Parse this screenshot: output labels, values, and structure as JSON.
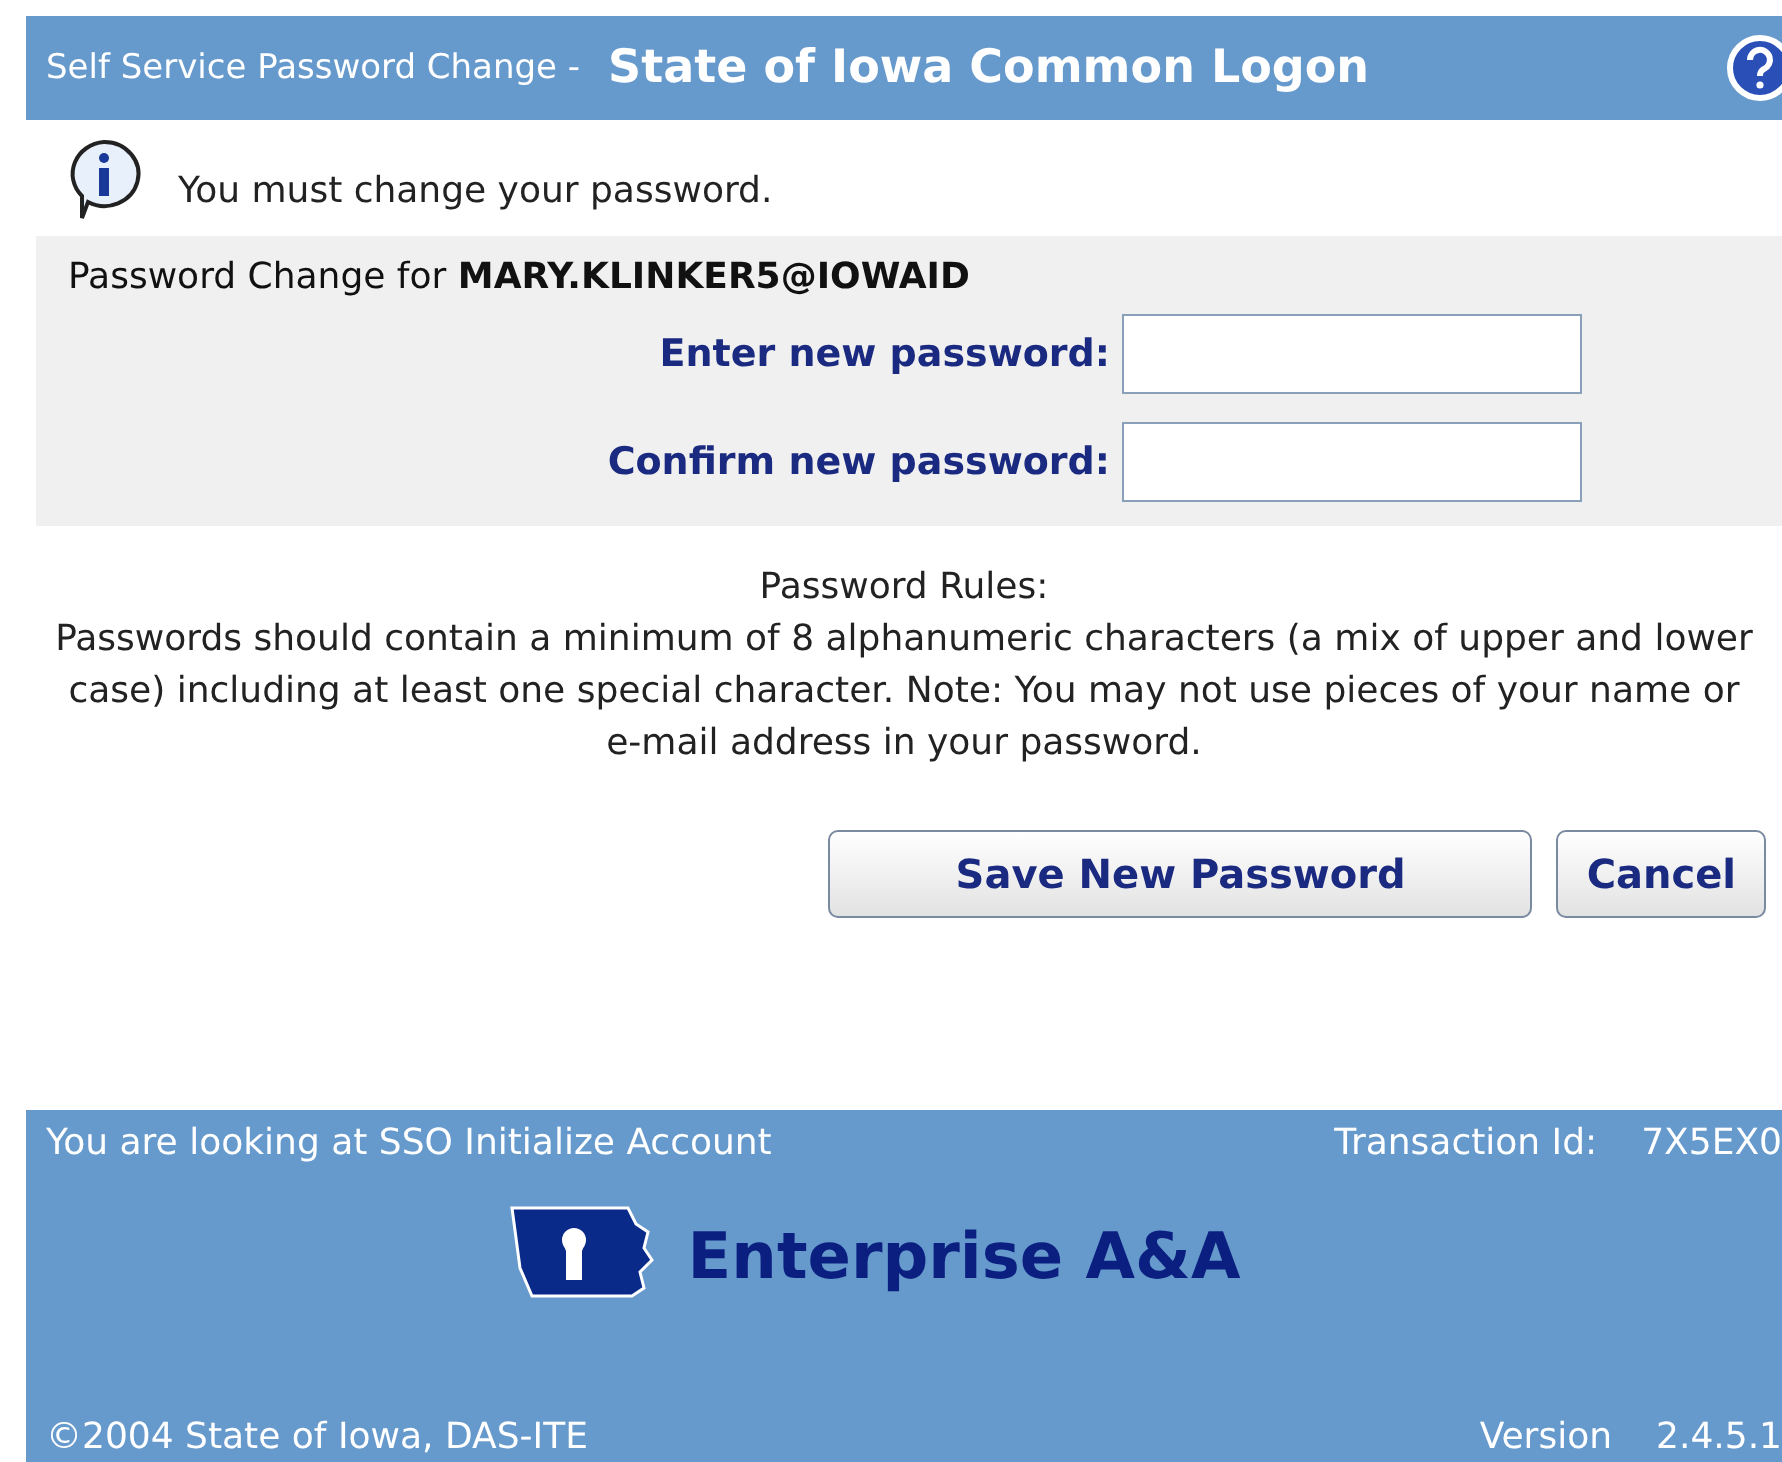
{
  "header": {
    "subtitle": "Self Service Password Change -",
    "title": "State of Iowa Common Logon"
  },
  "message": "You must change your password.",
  "form": {
    "heading": "Password Change for **MARY.KLINKER5@IOWAID**",
    "fields": [
      {
        "label": "Enter new password:"
      },
      {
        "label": "Confirm new password:"
      }
    ]
  },
  "rules": {
    "title": "Password Rules:",
    "text": "Passwords should contain a minimum of 8 alphanumeric characters (a mix of upper and lower case) including at least one special character. Note: You may not use pieces of your name or e-mail address in your password."
  },
  "buttons": [
    "Save New Password",
    "Cancel"
  ],
  "footer": {
    "location": "You are looking at SSO Initialize Account",
    "transaction_label": "Transaction Id:",
    "transaction_id": "7X5EX0",
    "logo_text": "Enterprise A&A",
    "copyright": "©2004 State of Iowa, DAS-ITE",
    "version_label": "Version",
    "version": "2.4.5.1"
  }
}
